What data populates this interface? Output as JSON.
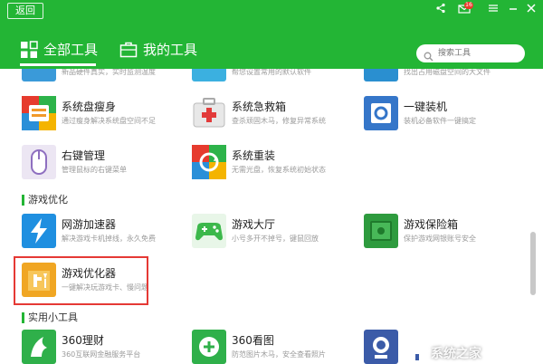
{
  "header": {
    "back_label": "返回",
    "mail_count": "16",
    "tabs": [
      {
        "label": "全部工具"
      },
      {
        "label": "我的工具"
      }
    ],
    "search_placeholder": "搜索工具"
  },
  "rows_top_partial": [
    {
      "desc": "新品硬件真实，实时监测温度"
    },
    {
      "desc": "帮您设置常用的默认软件"
    },
    {
      "desc": "找出占用磁盘空间的大文件"
    }
  ],
  "system_tools": [
    {
      "name": "系统盘瘦身",
      "desc": "通过瘦身解决系统盘空间不足",
      "icon": "system-disk-slim-icon"
    },
    {
      "name": "系统急救箱",
      "desc": "查杀顽固木马，修复异常系统",
      "icon": "first-aid-kit-icon"
    },
    {
      "name": "一键装机",
      "desc": "装机必备软件一键搞定",
      "icon": "one-click-install-icon"
    },
    {
      "name": "右键管理",
      "desc": "管理鼠标的右键菜单",
      "icon": "mouse-icon"
    },
    {
      "name": "系统重装",
      "desc": "无需光盘，恢复系统初始状态",
      "icon": "system-reinstall-icon"
    }
  ],
  "sections": {
    "game": "游戏优化",
    "utility": "实用小工具"
  },
  "game_tools": [
    {
      "name": "网游加速器",
      "desc": "解决游戏卡机掉线，永久免费",
      "icon": "lightning-icon"
    },
    {
      "name": "游戏大厅",
      "desc": "小号多开不掉号，键鼠回放",
      "icon": "gamepad-icon"
    },
    {
      "name": "游戏保险箱",
      "desc": "保护游戏网银账号安全",
      "icon": "safe-box-icon"
    },
    {
      "name": "游戏优化器",
      "desc": "一键解决玩游戏卡、慢问题",
      "icon": "game-optimizer-icon"
    }
  ],
  "utility_tools": [
    {
      "name": "360理财",
      "desc": "360互联网金融服务平台",
      "icon": "finance-icon"
    },
    {
      "name": "360看图",
      "desc": "防范图片木马，安全查看照片",
      "icon": "image-viewer-icon"
    },
    {
      "name": "",
      "desc": "",
      "icon": "camera-icon"
    }
  ],
  "watermark": "系统之家",
  "colors": {
    "brand_green": "#23b535",
    "highlight_red": "#e53935"
  }
}
